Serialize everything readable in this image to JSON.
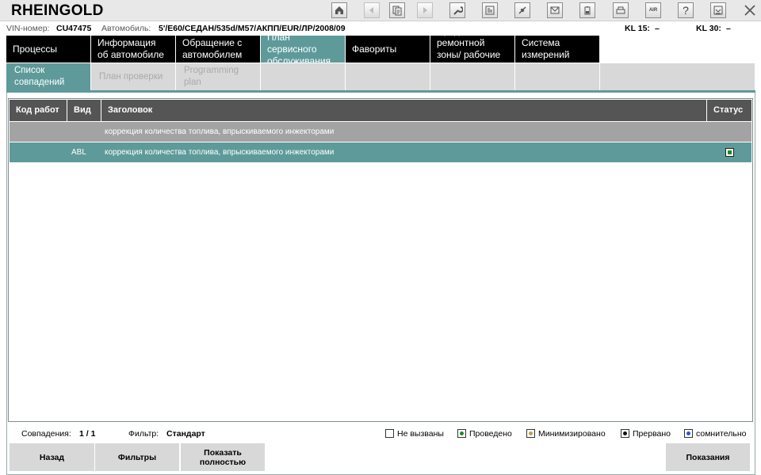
{
  "app": {
    "title": "RHEINGOLD"
  },
  "toolbar": {
    "buttons": [
      {
        "icon": "home-icon"
      },
      {
        "icon": "back-icon"
      },
      {
        "icon": "document-icon"
      },
      {
        "icon": "forward-icon"
      },
      {
        "icon": "wrench-icon"
      },
      {
        "icon": "data-icon"
      },
      {
        "icon": "connect-icon"
      },
      {
        "icon": "mail-icon"
      },
      {
        "icon": "battery-icon"
      },
      {
        "icon": "print-icon"
      },
      {
        "icon": "air-icon",
        "text": "AIR"
      },
      {
        "icon": "help-icon",
        "text": "?"
      },
      {
        "icon": "minimize-icon"
      },
      {
        "icon": "close-icon"
      }
    ]
  },
  "vehicle": {
    "vin_label": "VIN-номер:",
    "vin_value": "CU47475",
    "car_label": "Автомобиль:",
    "car_value": "5'/E60/СЕДАН/535d/M57/АКПП/EUR/ЛР/2008/09",
    "kl15_label": "KL 15:",
    "kl15_value": "–",
    "kl30_label": "KL 30:",
    "kl30_value": "–"
  },
  "tabs": [
    {
      "label": "Процессы"
    },
    {
      "label": "Информация об автомобиле"
    },
    {
      "label": "Обращение с автомобилем"
    },
    {
      "label": "План сервисного обслуживания",
      "active": true
    },
    {
      "label": "Фавориты"
    },
    {
      "label": "Средства ремонтной зоны/ рабочие жидкости"
    },
    {
      "label": "Система измерений"
    }
  ],
  "subtabs": [
    {
      "label": "Список совпадений",
      "active": true
    },
    {
      "label": "План проверки"
    },
    {
      "label": "Programming plan"
    }
  ],
  "table": {
    "columns": [
      "Код работ",
      "Вид",
      "Заголовок",
      "Статус"
    ],
    "rows": [
      {
        "code": "",
        "kind": "",
        "title": "коррекция количества топлива, впрыскиваемого инжекторами",
        "status": ""
      },
      {
        "code": "",
        "kind": "ABL",
        "title": "коррекция количества топлива, впрыскиваемого инжекторами",
        "status": "Проведено"
      }
    ]
  },
  "footer": {
    "matches_label": "Совпадения:",
    "matches_value": "1 / 1",
    "filter_label": "Фильтр:",
    "filter_value": "Стандарт",
    "legend": [
      {
        "label": "Не вызваны",
        "color": "#ffffff"
      },
      {
        "label": "Проведено",
        "color": "#1a8a2a"
      },
      {
        "label": "Минимизировано",
        "color": "#b8a24a"
      },
      {
        "label": "Прервано",
        "color": "#111111"
      },
      {
        "label": "сомнительно",
        "color": "#3355cc"
      }
    ],
    "buttons": {
      "back": "Назад",
      "filters": "Фильтры",
      "show_full": "Показать полностью",
      "readings": "Показания"
    }
  },
  "colors": {
    "accent": "#5f9a9a",
    "header": "#555555",
    "tab_bg": "#000000"
  }
}
